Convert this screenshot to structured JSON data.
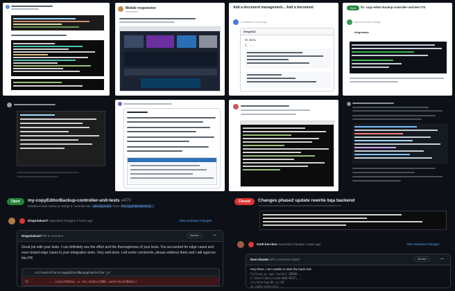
{
  "tiles": {
    "t2": {
      "title": "Mobile responsive",
      "comment": "...",
      "sub": "commented"
    },
    "t3": {
      "title": "Add a document management... Add a document",
      "author": "DiegoS11",
      "comment": "Hi Jurio,",
      "sub": "commented 4 hours ago"
    },
    "t4": {
      "badge": "Open",
      "title": "fix: copy-editor-backup-controller-unit-test #70",
      "author": "diegosalas",
      "sub": "approved these changes"
    }
  },
  "bottom_left": {
    "badge": "Open",
    "title": "my-copyEditorBackup-controller-unit-tests",
    "pr_number": "#470",
    "subline_author": "DiSalvo-Frank",
    "subline_text": "wants to merge 3 commits into",
    "base_branch": "development",
    "from_word": "from",
    "head_branch": "fix/copyEditorBackup...",
    "review_author": "DiegoSalas27",
    "review_text": "requested changes 2 hours ago",
    "view_link": "View reviewed changes",
    "comment_author": "DiegoSalas27",
    "comment_left": "left a comment",
    "role": "Member",
    "comment_body": "Great job with your tests. I can definitely see the effort and the thoroughness of your tests. You accounted for edge cases and even tested edge cases in your integration tests. Very well done. Left some comments, please address them and I will approve this PR",
    "file_path": "src/controllers/copyEditorBackupController.js",
    "code_line_number": "56",
    "code_line": "...(resultData) => res.status(200).send(resultData))"
  },
  "bottom_right": {
    "badge": "Closed",
    "title": "Changes phase2 update rewrite bqa backend",
    "pr_number": "#??",
    "review_author": "Goth-ben-bns",
    "review_text": "requested changes 4 days ago",
    "view_link": "View reviewed changes",
    "comment_author": "Ravi-shanks",
    "comment_left": "left a comment",
    "edited": "edited",
    "role": "Member",
    "greeting": "Hey there, I am unable to start the back end",
    "line2": "Failing as npm install ERROR...",
    "line3": "C:\\Users\\Ravi\\code\\HGN-REST\\...",
    "line4": "src/startup/db.js:18",
    "line5": "at node:internal/..."
  }
}
